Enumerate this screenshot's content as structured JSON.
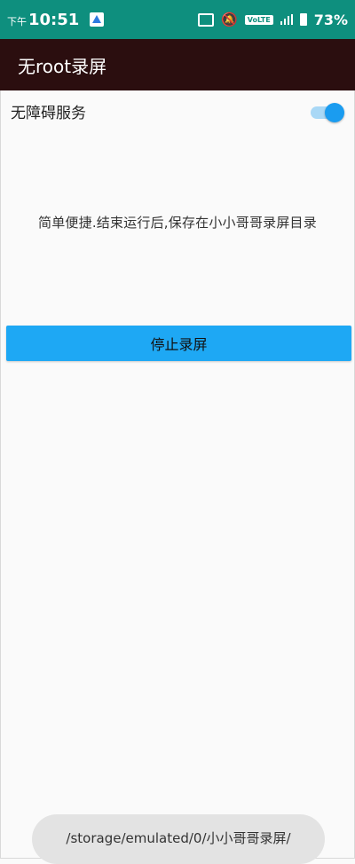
{
  "status_bar": {
    "time_prefix": "下午",
    "time": "10:51",
    "volte": "VoLTE",
    "battery": "73%",
    "icons": [
      "notification-icon",
      "cast-icon",
      "mute-icon",
      "volte-icon",
      "signal-icon",
      "battery-icon"
    ]
  },
  "app_bar": {
    "title": "无root录屏"
  },
  "accessibility": {
    "label": "无障碍服务",
    "enabled": true
  },
  "description": "简单便捷.结束运行后,保存在小小哥哥录屏目录",
  "stop_button": {
    "label": "停止录屏"
  },
  "toast": {
    "text": "/storage/emulated/0/小小哥哥录屏/"
  },
  "colors": {
    "status_bar": "#0e8f7e",
    "app_bar": "#2b0e0f",
    "accent": "#1ea8f4",
    "background": "#fafafa"
  }
}
